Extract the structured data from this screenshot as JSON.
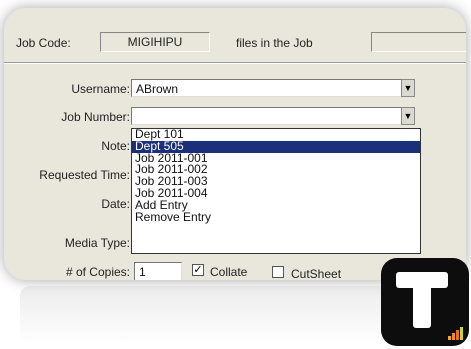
{
  "header": {
    "job_code_label": "Job Code:",
    "job_code_value": "MIGIHIPU",
    "files_label": "files in the Job"
  },
  "form": {
    "username_label": "Username:",
    "username_value": "ABrown",
    "job_number_label": "Job Number:",
    "job_number_value": "",
    "note_label": "Note:",
    "requested_time_label": "Requested Time:",
    "date_label": "Date:",
    "media_type_label": "Media Type:",
    "copies_label": "# of Copies:",
    "copies_value": "1",
    "collate_label": "Collate",
    "collate_checked": true,
    "cutsheet_label": "CutSheet",
    "cutsheet_checked": false
  },
  "dropdown": {
    "items": [
      "Dept 101",
      "Dept 505",
      "Job 2011-001",
      "Job 2011-002",
      "Job 2011-003",
      "Job 2011-004",
      "Add Entry",
      "Remove Entry"
    ],
    "selected_index": 1
  },
  "icons": {
    "combo_arrow": "chevron-down-icon",
    "badge": "t-logo-icon",
    "signal": "signal-bars-icon"
  },
  "colors": {
    "selection": "#1b2f7a",
    "window_bg": "#e9e6dc",
    "badge_bg": "#0d0d0d",
    "bar_colors": [
      "#f5a623",
      "#f08a24",
      "#e8692a",
      "#c9d62e"
    ]
  }
}
